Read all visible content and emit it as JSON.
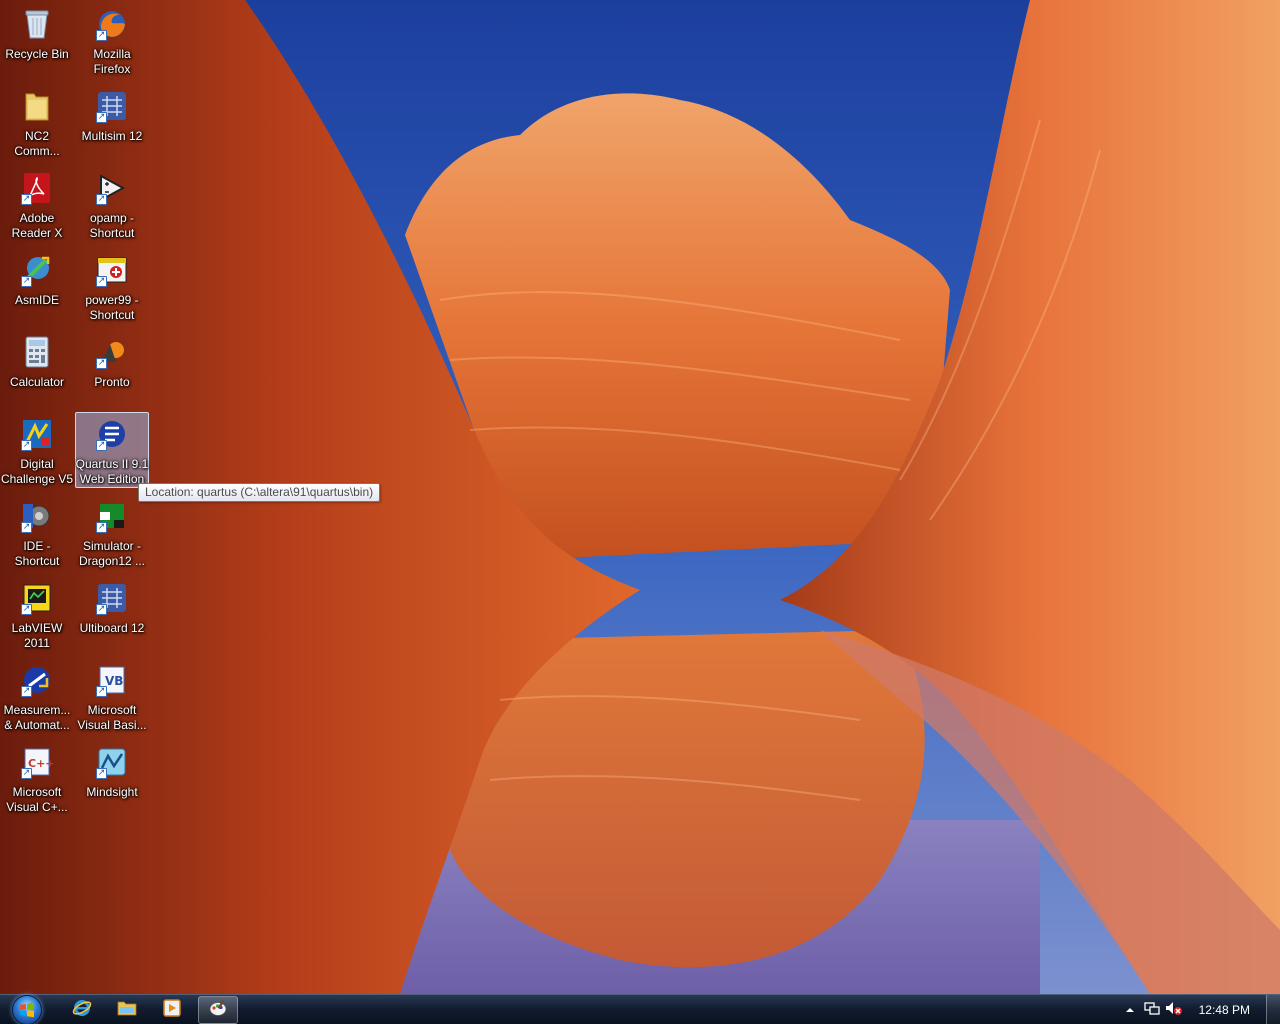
{
  "desktop": {
    "icons": [
      {
        "label": "Recycle Bin",
        "icon": "recycle-bin-icon"
      },
      {
        "label": "Mozilla\nFirefox",
        "icon": "firefox-icon"
      },
      {
        "label": "NC2\nComm...",
        "icon": "folder-icon"
      },
      {
        "label": "Multisim 12",
        "icon": "multisim-icon"
      },
      {
        "label": "Adobe\nReader X",
        "icon": "adobe-reader-icon"
      },
      {
        "label": "opamp -\nShortcut",
        "icon": "opamp-icon"
      },
      {
        "label": "AsmIDE",
        "icon": "asmide-icon"
      },
      {
        "label": "power99 -\nShortcut",
        "icon": "power99-icon"
      },
      {
        "label": "Calculator",
        "icon": "calculator-icon"
      },
      {
        "label": "Pronto",
        "icon": "pronto-icon"
      },
      {
        "label": "Digital\nChallenge V5",
        "icon": "digital-challenge-icon"
      },
      {
        "label": "Quartus II 9.1\nWeb Edition",
        "icon": "quartus-icon"
      },
      {
        "label": "IDE -\nShortcut",
        "icon": "ide-icon"
      },
      {
        "label": "Simulator -\nDragon12 ...",
        "icon": "simulator-icon"
      },
      {
        "label": "LabVIEW\n2011",
        "icon": "labview-icon"
      },
      {
        "label": "Ultiboard 12",
        "icon": "ultiboard-icon"
      },
      {
        "label": "Measurem...\n& Automat...",
        "icon": "measurement-automation-icon"
      },
      {
        "label": "Microsoft\nVisual Basi...",
        "icon": "visual-basic-icon"
      },
      {
        "label": "Microsoft\nVisual C+...",
        "icon": "visual-cpp-icon"
      },
      {
        "label": "Mindsight",
        "icon": "mindsight-icon"
      }
    ],
    "selected": "Quartus II 9.1\nWeb Edition"
  },
  "tooltip": {
    "text": "Location: quartus (C:\\altera\\91\\quartus\\bin)"
  },
  "taskbar": {
    "start_icon": "windows-start-icon",
    "pinned": [
      {
        "icon": "internet-explorer-icon"
      },
      {
        "icon": "windows-explorer-icon"
      },
      {
        "icon": "media-player-icon"
      },
      {
        "icon": "paint-icon"
      }
    ],
    "tray": {
      "icons": [
        "show-hidden-icons-icon",
        "network-icon",
        "volume-muted-icon"
      ],
      "clock": "12:48 PM"
    }
  },
  "colors": {
    "sky": "#2a55b5",
    "rock": "#d45a2a",
    "taskbar": "#141c2c",
    "selection": "#96b4e6"
  }
}
